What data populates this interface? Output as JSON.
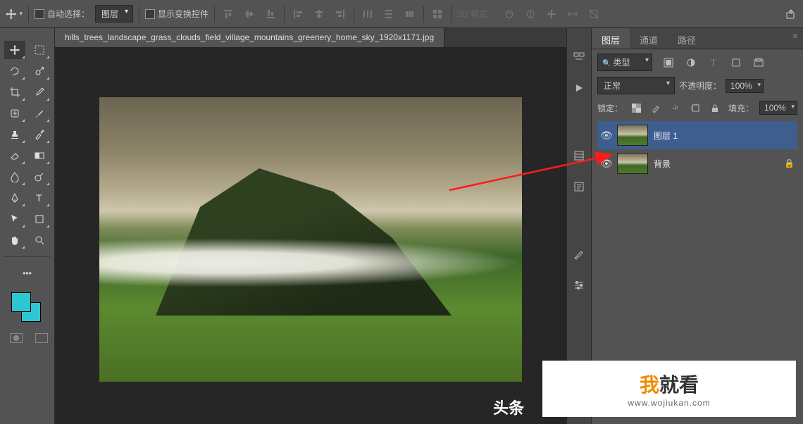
{
  "options": {
    "auto_select_label": "自动选择：",
    "auto_select_target": "图层",
    "show_transform_label": "显示变换控件",
    "mode3d_label": "3D 模式："
  },
  "document": {
    "tab_title": "hills_trees_landscape_grass_clouds_field_village_mountains_greenery_home_sky_1920x1171.jpg",
    "bottom_text": "头条"
  },
  "layers": {
    "tabs": [
      "图层",
      "通道",
      "路径"
    ],
    "filter_label": "类型",
    "blend_mode": "正常",
    "opacity_label": "不透明度：",
    "opacity_value": "100%",
    "lock_label": "锁定：",
    "fill_label": "填充：",
    "fill_value": "100%",
    "items": [
      {
        "name": "图层 1",
        "locked": false,
        "visible": true
      },
      {
        "name": "背景",
        "locked": true,
        "visible": true
      }
    ]
  },
  "watermark": {
    "brand_orange": "我",
    "brand_rest": "就看",
    "url": "www.wojiukan.com"
  }
}
